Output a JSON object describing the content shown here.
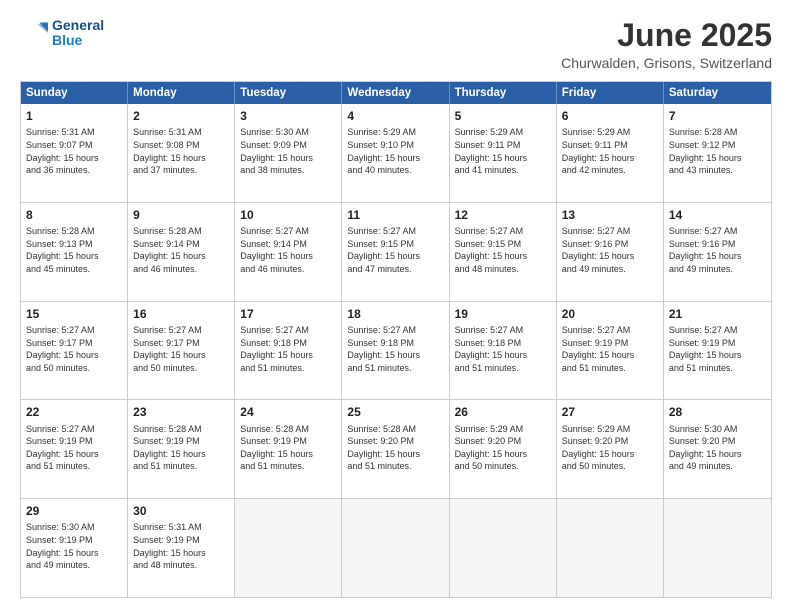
{
  "header": {
    "logo_line1": "General",
    "logo_line2": "Blue",
    "title": "June 2025",
    "subtitle": "Churwalden, Grisons, Switzerland"
  },
  "calendar": {
    "days_of_week": [
      "Sunday",
      "Monday",
      "Tuesday",
      "Wednesday",
      "Thursday",
      "Friday",
      "Saturday"
    ],
    "rows": [
      [
        {
          "day": "",
          "empty": true
        },
        {
          "day": "2",
          "lines": [
            "Sunrise: 5:31 AM",
            "Sunset: 9:08 PM",
            "Daylight: 15 hours",
            "and 37 minutes."
          ]
        },
        {
          "day": "3",
          "lines": [
            "Sunrise: 5:30 AM",
            "Sunset: 9:09 PM",
            "Daylight: 15 hours",
            "and 38 minutes."
          ]
        },
        {
          "day": "4",
          "lines": [
            "Sunrise: 5:29 AM",
            "Sunset: 9:10 PM",
            "Daylight: 15 hours",
            "and 40 minutes."
          ]
        },
        {
          "day": "5",
          "lines": [
            "Sunrise: 5:29 AM",
            "Sunset: 9:11 PM",
            "Daylight: 15 hours",
            "and 41 minutes."
          ]
        },
        {
          "day": "6",
          "lines": [
            "Sunrise: 5:29 AM",
            "Sunset: 9:11 PM",
            "Daylight: 15 hours",
            "and 42 minutes."
          ]
        },
        {
          "day": "7",
          "lines": [
            "Sunrise: 5:28 AM",
            "Sunset: 9:12 PM",
            "Daylight: 15 hours",
            "and 43 minutes."
          ]
        }
      ],
      [
        {
          "day": "8",
          "lines": [
            "Sunrise: 5:28 AM",
            "Sunset: 9:13 PM",
            "Daylight: 15 hours",
            "and 45 minutes."
          ]
        },
        {
          "day": "9",
          "lines": [
            "Sunrise: 5:28 AM",
            "Sunset: 9:14 PM",
            "Daylight: 15 hours",
            "and 46 minutes."
          ]
        },
        {
          "day": "10",
          "lines": [
            "Sunrise: 5:27 AM",
            "Sunset: 9:14 PM",
            "Daylight: 15 hours",
            "and 46 minutes."
          ]
        },
        {
          "day": "11",
          "lines": [
            "Sunrise: 5:27 AM",
            "Sunset: 9:15 PM",
            "Daylight: 15 hours",
            "and 47 minutes."
          ]
        },
        {
          "day": "12",
          "lines": [
            "Sunrise: 5:27 AM",
            "Sunset: 9:15 PM",
            "Daylight: 15 hours",
            "and 48 minutes."
          ]
        },
        {
          "day": "13",
          "lines": [
            "Sunrise: 5:27 AM",
            "Sunset: 9:16 PM",
            "Daylight: 15 hours",
            "and 49 minutes."
          ]
        },
        {
          "day": "14",
          "lines": [
            "Sunrise: 5:27 AM",
            "Sunset: 9:16 PM",
            "Daylight: 15 hours",
            "and 49 minutes."
          ]
        }
      ],
      [
        {
          "day": "15",
          "lines": [
            "Sunrise: 5:27 AM",
            "Sunset: 9:17 PM",
            "Daylight: 15 hours",
            "and 50 minutes."
          ]
        },
        {
          "day": "16",
          "lines": [
            "Sunrise: 5:27 AM",
            "Sunset: 9:17 PM",
            "Daylight: 15 hours",
            "and 50 minutes."
          ]
        },
        {
          "day": "17",
          "lines": [
            "Sunrise: 5:27 AM",
            "Sunset: 9:18 PM",
            "Daylight: 15 hours",
            "and 51 minutes."
          ]
        },
        {
          "day": "18",
          "lines": [
            "Sunrise: 5:27 AM",
            "Sunset: 9:18 PM",
            "Daylight: 15 hours",
            "and 51 minutes."
          ]
        },
        {
          "day": "19",
          "lines": [
            "Sunrise: 5:27 AM",
            "Sunset: 9:18 PM",
            "Daylight: 15 hours",
            "and 51 minutes."
          ]
        },
        {
          "day": "20",
          "lines": [
            "Sunrise: 5:27 AM",
            "Sunset: 9:19 PM",
            "Daylight: 15 hours",
            "and 51 minutes."
          ]
        },
        {
          "day": "21",
          "lines": [
            "Sunrise: 5:27 AM",
            "Sunset: 9:19 PM",
            "Daylight: 15 hours",
            "and 51 minutes."
          ]
        }
      ],
      [
        {
          "day": "22",
          "lines": [
            "Sunrise: 5:27 AM",
            "Sunset: 9:19 PM",
            "Daylight: 15 hours",
            "and 51 minutes."
          ]
        },
        {
          "day": "23",
          "lines": [
            "Sunrise: 5:28 AM",
            "Sunset: 9:19 PM",
            "Daylight: 15 hours",
            "and 51 minutes."
          ]
        },
        {
          "day": "24",
          "lines": [
            "Sunrise: 5:28 AM",
            "Sunset: 9:19 PM",
            "Daylight: 15 hours",
            "and 51 minutes."
          ]
        },
        {
          "day": "25",
          "lines": [
            "Sunrise: 5:28 AM",
            "Sunset: 9:20 PM",
            "Daylight: 15 hours",
            "and 51 minutes."
          ]
        },
        {
          "day": "26",
          "lines": [
            "Sunrise: 5:29 AM",
            "Sunset: 9:20 PM",
            "Daylight: 15 hours",
            "and 50 minutes."
          ]
        },
        {
          "day": "27",
          "lines": [
            "Sunrise: 5:29 AM",
            "Sunset: 9:20 PM",
            "Daylight: 15 hours",
            "and 50 minutes."
          ]
        },
        {
          "day": "28",
          "lines": [
            "Sunrise: 5:30 AM",
            "Sunset: 9:20 PM",
            "Daylight: 15 hours",
            "and 49 minutes."
          ]
        }
      ],
      [
        {
          "day": "29",
          "lines": [
            "Sunrise: 5:30 AM",
            "Sunset: 9:19 PM",
            "Daylight: 15 hours",
            "and 49 minutes."
          ]
        },
        {
          "day": "30",
          "lines": [
            "Sunrise: 5:31 AM",
            "Sunset: 9:19 PM",
            "Daylight: 15 hours",
            "and 48 minutes."
          ]
        },
        {
          "day": "",
          "empty": true
        },
        {
          "day": "",
          "empty": true
        },
        {
          "day": "",
          "empty": true
        },
        {
          "day": "",
          "empty": true
        },
        {
          "day": "",
          "empty": true
        }
      ]
    ],
    "row0_sunday": {
      "day": "1",
      "lines": [
        "Sunrise: 5:31 AM",
        "Sunset: 9:07 PM",
        "Daylight: 15 hours",
        "and 36 minutes."
      ]
    }
  }
}
